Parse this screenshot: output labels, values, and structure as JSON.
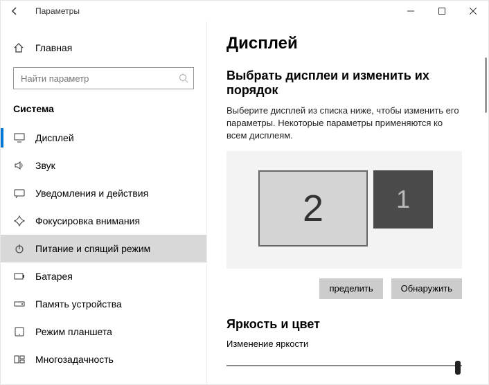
{
  "window": {
    "app_title": "Параметры"
  },
  "sidebar": {
    "home_label": "Главная",
    "search_placeholder": "Найти параметр",
    "section_title": "Система",
    "items": [
      {
        "icon": "display",
        "label": "Дисплей"
      },
      {
        "icon": "sound",
        "label": "Звук"
      },
      {
        "icon": "notify",
        "label": "Уведомления и действия"
      },
      {
        "icon": "focus",
        "label": "Фокусировка внимания"
      },
      {
        "icon": "power",
        "label": "Питание и спящий режим"
      },
      {
        "icon": "battery",
        "label": "Батарея"
      },
      {
        "icon": "storage",
        "label": "Память устройства"
      },
      {
        "icon": "tablet",
        "label": "Режим планшета"
      },
      {
        "icon": "multi",
        "label": "Многозадачность"
      }
    ]
  },
  "main": {
    "heading": "Дисплей",
    "sub1_heading": "Выбрать дисплеи и изменить их порядок",
    "sub1_desc": "Выберите дисплей из списка ниже, чтобы изменить его параметры. Некоторые параметры применяются ко всем дисплеям.",
    "monitor_primary": "2",
    "monitor_secondary": "1",
    "identify_btn": "пределить",
    "detect_btn": "Обнаружить",
    "sub2_heading": "Яркость и цвет",
    "brightness_label": "Изменение яркости",
    "brightness_value": 100
  }
}
